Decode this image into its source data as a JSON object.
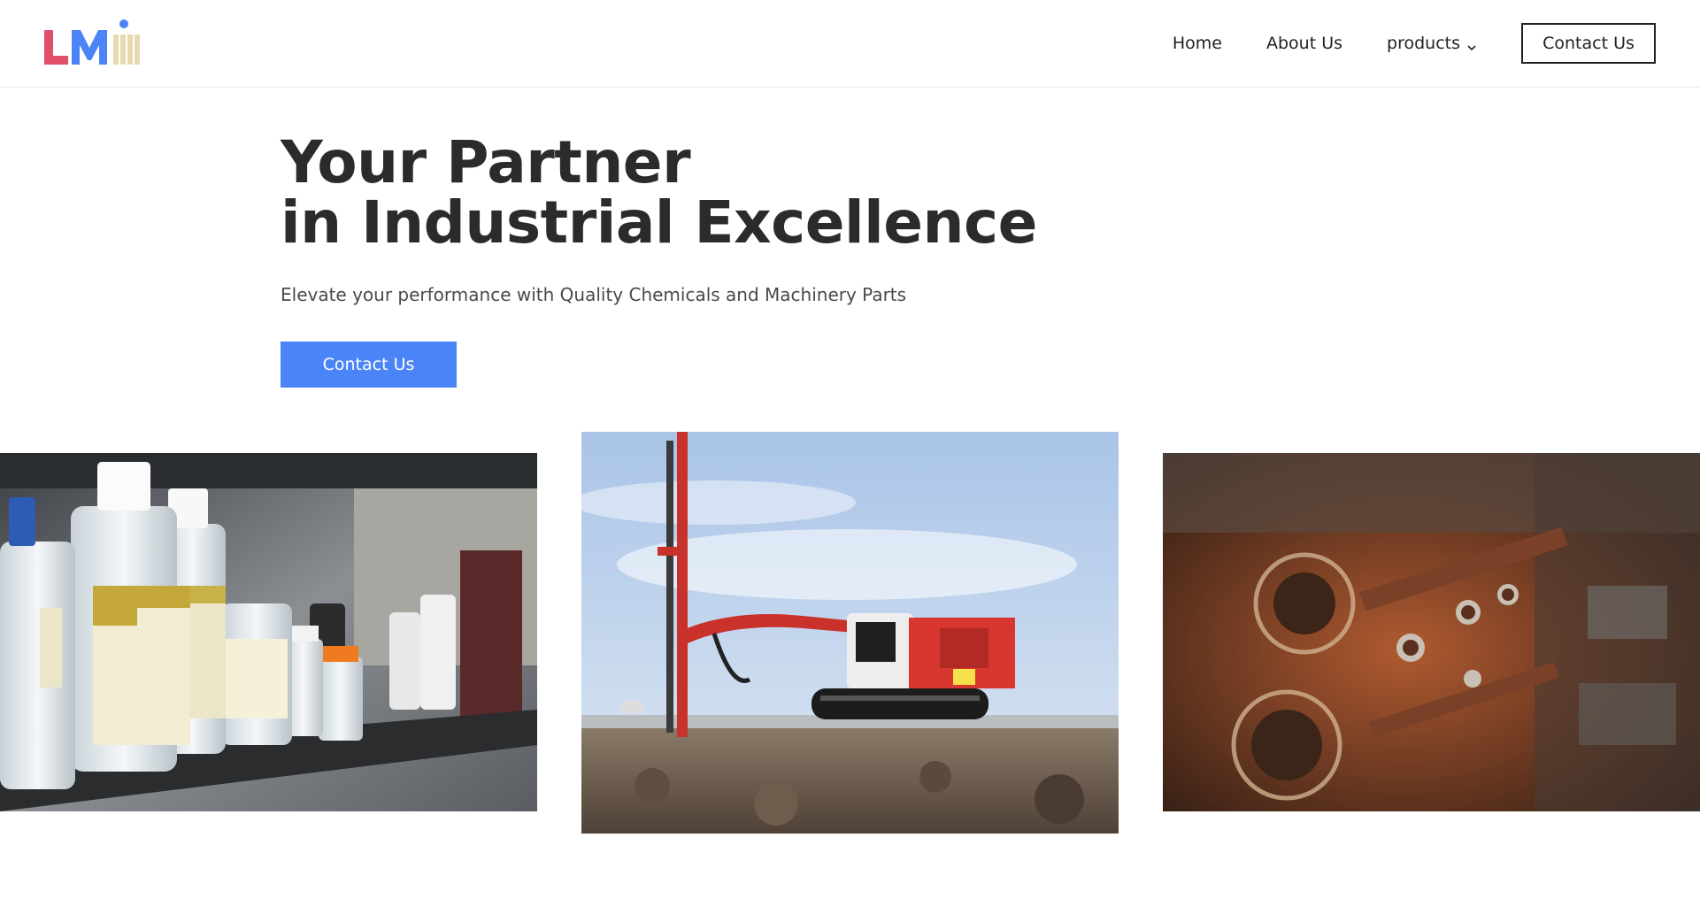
{
  "header": {
    "logo_text": "LMI",
    "nav": [
      {
        "label": "Home"
      },
      {
        "label": "About Us"
      },
      {
        "label": "products",
        "has_dropdown": true
      }
    ],
    "contact_label": "Contact Us"
  },
  "hero": {
    "title_line1": "Your Partner",
    "title_line2": "in Industrial Excellence",
    "subtitle": "Elevate your performance with Quality Chemicals and Machinery Parts",
    "cta_label": "Contact Us"
  },
  "colors": {
    "accent": "#4b84f7",
    "logo_l": "#e0506a",
    "logo_m": "#4b84f7",
    "logo_i": "#e8d9ae"
  },
  "icons": {
    "dropdown": "chevron-down-icon"
  }
}
